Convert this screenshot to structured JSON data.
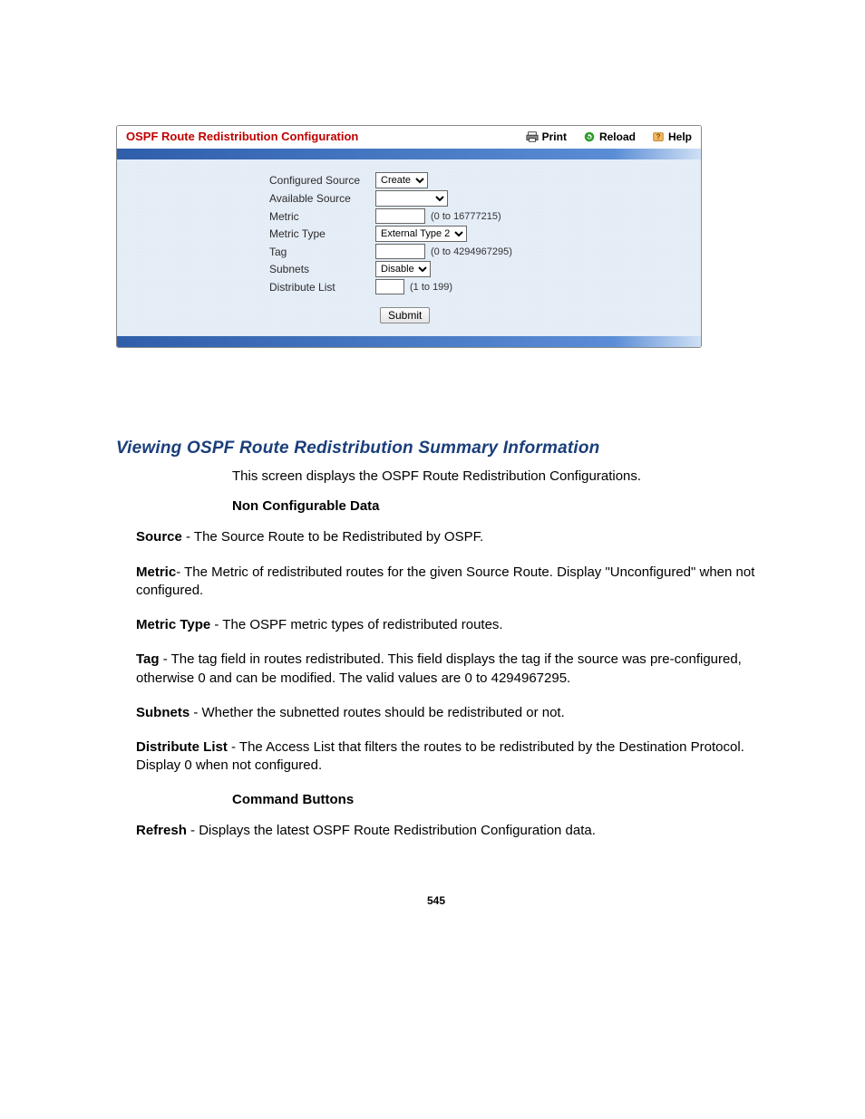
{
  "panel": {
    "title": "OSPF Route Redistribution Configuration",
    "actions": {
      "print": "Print",
      "reload": "Reload",
      "help": "Help"
    },
    "form": {
      "conf_source": {
        "label": "Configured Source",
        "value": "Create"
      },
      "avail_source": {
        "label": "Available Source",
        "value": ""
      },
      "metric": {
        "label": "Metric",
        "value": "",
        "hint": "(0 to 16777215)"
      },
      "metric_type": {
        "label": "Metric Type",
        "value": "External Type 2"
      },
      "tag": {
        "label": "Tag",
        "value": "",
        "hint": "(0 to 4294967295)"
      },
      "subnets": {
        "label": "Subnets",
        "value": "Disable"
      },
      "dist_list": {
        "label": "Distribute List",
        "value": "",
        "hint": "(1 to 199)"
      },
      "submit_label": "Submit"
    }
  },
  "section": {
    "heading": "Viewing OSPF Route Redistribution Summary Information",
    "intro": "This screen displays the OSPF Route Redistribution Configurations.",
    "non_config_heading": "Non Configurable Data",
    "items": {
      "source": {
        "term": "Source",
        "desc": " - The Source Route to be Redistributed by OSPF."
      },
      "metric": {
        "term": "Metric",
        "desc": "- The Metric of redistributed routes for the given Source Route. Display \"Unconfigured\" when not configured."
      },
      "metric_type": {
        "term": "Metric Type",
        "desc": " - The OSPF metric types of redistributed routes."
      },
      "tag": {
        "term": "Tag",
        "desc": " - The tag field in routes redistributed. This field displays the tag if the source was pre-configured, otherwise 0 and can be modified. The valid values are 0 to 4294967295."
      },
      "subnets": {
        "term": "Subnets",
        "desc": " - Whether the subnetted routes should be redistributed or not."
      },
      "dist_list": {
        "term": "Distribute List",
        "desc": " - The Access List that filters the routes to be redistributed by the Destination Protocol. Display 0 when not configured."
      }
    },
    "cmd_heading": "Command Buttons",
    "cmd": {
      "refresh": {
        "term": "Refresh",
        "desc": " - Displays the latest OSPF Route Redistribution Configuration data."
      }
    }
  },
  "page_number": "545"
}
